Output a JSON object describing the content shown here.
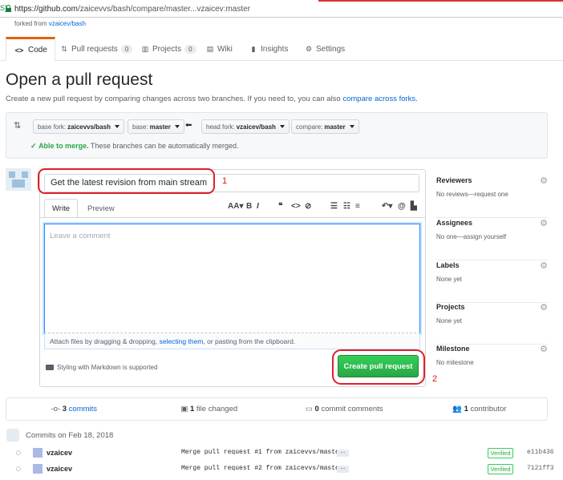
{
  "browser": {
    "left_mark": "S]",
    "url_host": "https://github.com",
    "url_path": "/zaicevvs/bash/compare/master...vzaicev:master"
  },
  "repo": {
    "forked_prefix": "forked from",
    "forked_link": "vzaicev/bash"
  },
  "tabs": [
    {
      "label": "Code",
      "icon": "<>"
    },
    {
      "label": "Pull requests",
      "count": "0"
    },
    {
      "label": "Projects",
      "count": "0"
    },
    {
      "label": "Wiki"
    },
    {
      "label": "Insights"
    },
    {
      "label": "Settings"
    }
  ],
  "page": {
    "title": "Open a pull request",
    "subtitle": "Create a new pull request by comparing changes across two branches. If you need to, you can also",
    "subtitle_link": "compare across forks."
  },
  "range": {
    "base_fork_label": "base fork:",
    "base_fork": "zaicevvs/bash",
    "base_label": "base:",
    "base": "master",
    "head_fork_label": "head fork:",
    "head_fork": "vzaicev/bash",
    "compare_label": "compare:",
    "compare": "master",
    "merge_ok": "Able to merge.",
    "merge_text": "These branches can be automatically merged."
  },
  "form": {
    "title_value": "Get the latest revision from main stream",
    "write_tab": "Write",
    "preview_tab": "Preview",
    "comment_placeholder": "Leave a comment",
    "attach_prefix": "Attach files by dragging & dropping,",
    "attach_link": "selecting them",
    "attach_suffix": ", or pasting from the clipboard.",
    "markdown_note": "Styling with Markdown is supported",
    "submit_label": "Create pull request"
  },
  "annotations": {
    "mark1": "1",
    "mark2": "2"
  },
  "sidebar": [
    {
      "title": "Reviewers",
      "value": "No reviews—request one"
    },
    {
      "title": "Assignees",
      "value": "No one—assign yourself"
    },
    {
      "title": "Labels",
      "value": "None yet"
    },
    {
      "title": "Projects",
      "value": "None yet"
    },
    {
      "title": "Milestone",
      "value": "No milestone"
    }
  ],
  "stats": {
    "commits_num": "3",
    "commits_label": "commits",
    "files_num": "1",
    "files_label": "file changed",
    "comments_num": "0",
    "comments_label": "commit comments",
    "contrib_num": "1",
    "contrib_label": "contributor"
  },
  "commits_date": "Commits on Feb 18, 2018",
  "commits": [
    {
      "author": "vzaicev",
      "message": "Merge pull request #1 from zaicevvs/master",
      "verified": "Verified",
      "sha": "e11b436"
    },
    {
      "author": "vzaicev",
      "message": "Merge pull request #2 from zaicevvs/master",
      "verified": "Verified",
      "sha": "7121ff3"
    }
  ],
  "colors": {
    "accent_tab": "#e36209",
    "button_green": "#28a745",
    "annotation_red": "#e0202a",
    "link": "#0366d6"
  }
}
